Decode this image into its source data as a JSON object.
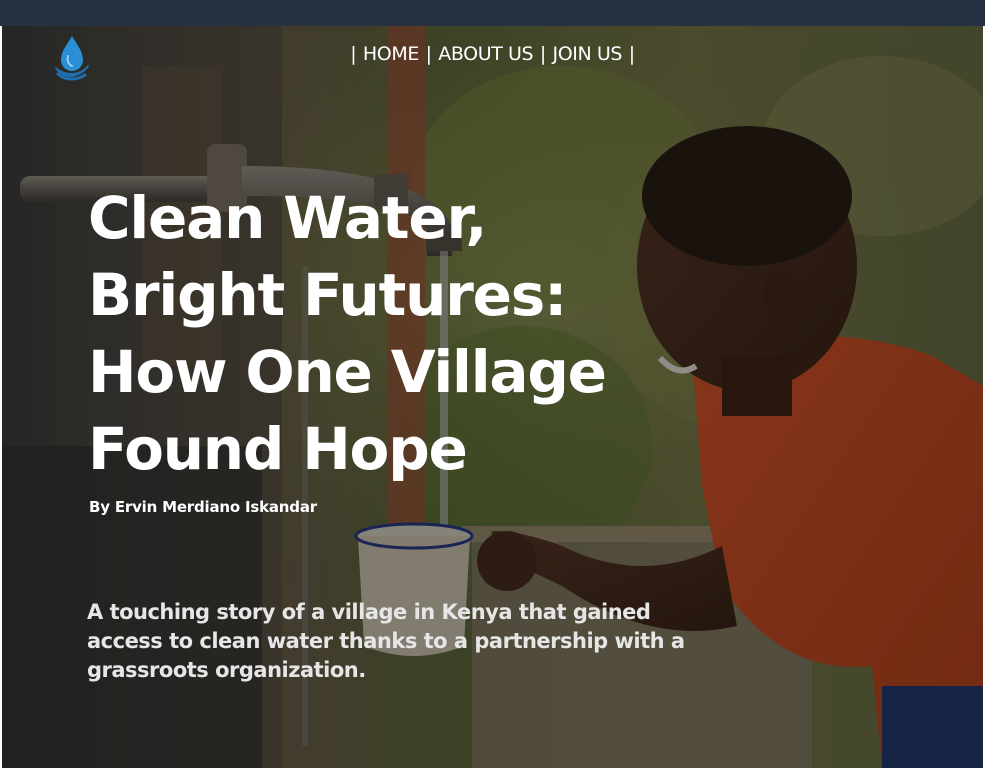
{
  "nav": {
    "separator": "|",
    "items": [
      "HOME",
      "ABOUT US",
      "JOIN US"
    ]
  },
  "logo": {
    "icon": "water-drop-hand-icon",
    "color": "#2b8fd6"
  },
  "hero": {
    "headline_lines": [
      "Clean Water,",
      "Bright Futures:",
      "How One Village",
      "Found Hope"
    ],
    "byline": "By Ervin Merdiano Iskandar",
    "summary_lines": [
      "A touching story of a village in Kenya that gained",
      "access to clean water thanks to a partnership with a",
      "grassroots organization."
    ],
    "photo": "child-drinking-from-tap-photo"
  },
  "colors": {
    "topbar": "#263241",
    "text": "#ffffff"
  }
}
